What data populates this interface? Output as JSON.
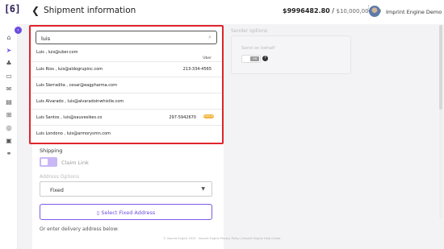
{
  "header": {
    "logo": "[6]",
    "back_icon": "chevron-left-icon",
    "title": "Shipment information",
    "balance_current": "$9996482.80",
    "balance_separator": " / ",
    "balance_total": "$10,000,000.00",
    "user_name": "Imprint Engine Demo"
  },
  "sidebar": {
    "collapse_icon": "chevron-right-icon",
    "items": [
      {
        "icon": "home-icon",
        "glyph": "⌂"
      },
      {
        "icon": "send-icon",
        "glyph": "➤",
        "active": true
      },
      {
        "icon": "group-icon",
        "glyph": "♣"
      },
      {
        "icon": "truck-icon",
        "glyph": "▭"
      },
      {
        "icon": "gift-icon",
        "glyph": "✉"
      },
      {
        "icon": "inventory-icon",
        "glyph": "▤"
      },
      {
        "icon": "grid-icon",
        "glyph": "⊞"
      },
      {
        "icon": "globe-icon",
        "glyph": "◎"
      },
      {
        "icon": "image-icon",
        "glyph": "▣"
      },
      {
        "icon": "link-icon",
        "glyph": "⚭"
      }
    ]
  },
  "search": {
    "value": "luis",
    "placeholder": ""
  },
  "results": [
    {
      "name": "Luis , luis@uber.com",
      "phone": "",
      "tag": "Uber"
    },
    {
      "name": "Luis Rios , luis@aldogrupinc.com",
      "phone": "213-334-4565",
      "tag": ""
    },
    {
      "name": "Luis Sierradita , cesar@eagpharma.com",
      "phone": "",
      "tag": ""
    },
    {
      "name": "Luis Alvarado , luis@alvaradoinwhistle.com",
      "phone": "",
      "tag": ""
    },
    {
      "name": "Luis Santos , luis@sauvesikes.co",
      "phone": "297-5942670",
      "tag": "",
      "badge": "Default"
    },
    {
      "name": "Luis Londono , luis@armorysmn.com",
      "phone": "",
      "tag": ""
    }
  ],
  "form": {
    "shipping_label": "Shipping",
    "claim_link_label": "Claim Link",
    "address_options_label": "Address Options",
    "address_options_value": "Fixed",
    "select_fixed_label": "Select Fixed Address",
    "enter_delivery_label": "Or enter delivery address below:"
  },
  "sender": {
    "options_label": "Sender options",
    "send_on_behalf_label": "Send on behalf",
    "toggle_text": "Off"
  },
  "footer": {
    "copyright": "© Imprint Engine 2025 · ",
    "privacy": "Imprint Engine Privacy Policy",
    "divider": " | ",
    "help": "Imprint Engine Help Center"
  },
  "colors": {
    "accent": "#6c4ce0",
    "highlight_border": "#e0242b",
    "badge": "#f2b43a"
  }
}
